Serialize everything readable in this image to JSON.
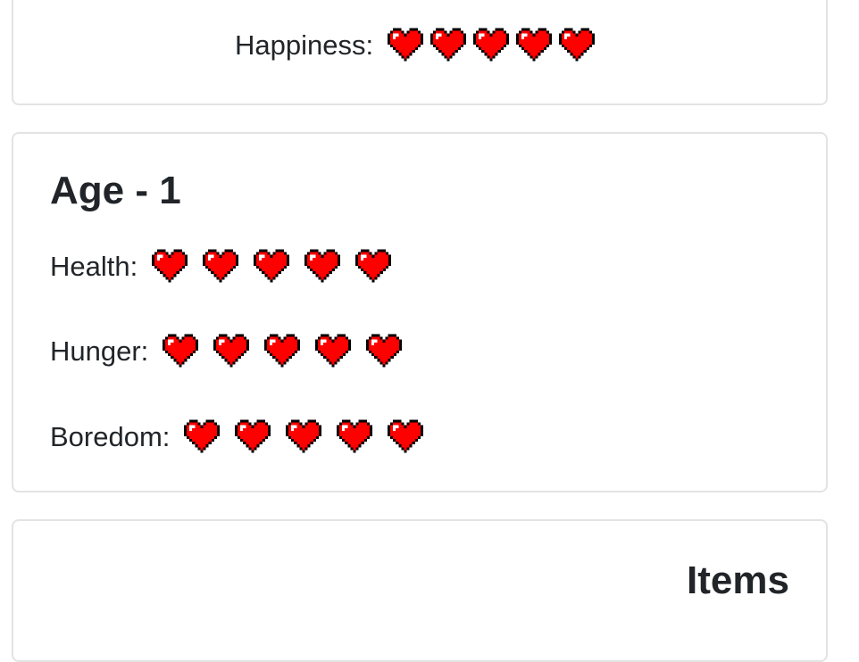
{
  "happiness": {
    "label": "Happiness:",
    "hearts": 5
  },
  "stats": {
    "title": "Age - 1",
    "health": {
      "label": "Health:",
      "hearts": 5
    },
    "hunger": {
      "label": "Hunger:",
      "hearts": 5
    },
    "boredom": {
      "label": "Boredom:",
      "hearts": 5
    }
  },
  "items": {
    "title": "Items"
  },
  "colors": {
    "heart_fill": "#ff0000",
    "heart_outline": "#000000",
    "card_border": "#e3e3e3",
    "text": "#212529"
  },
  "icons": {
    "heart": "pixel-heart-icon"
  }
}
